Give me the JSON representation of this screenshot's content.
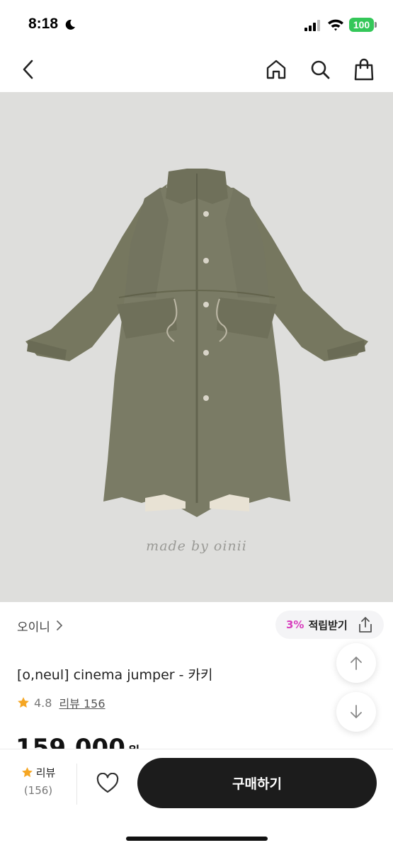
{
  "status_bar": {
    "time": "8:18",
    "battery": "100",
    "icons": [
      "moon-icon",
      "signal-icon",
      "wifi-icon"
    ]
  },
  "nav": {
    "icons": [
      "back-chevron-icon",
      "home-icon",
      "search-icon",
      "shopping-bag-icon"
    ]
  },
  "product": {
    "image_watermark": "made by oinii",
    "brand": "오이니",
    "reward": {
      "percent": "3%",
      "label": "적립받기"
    },
    "title": "[o,neul] cinema jumper - 카키",
    "rating": "4.8",
    "review_link": "리뷰 156",
    "price": "159,000",
    "price_unit": "원"
  },
  "bottom_bar": {
    "review_label": "리뷰",
    "review_count": "(156)",
    "buy_label": "구매하기"
  },
  "colors": {
    "accent_pink": "#d83fbd",
    "star": "#f5a623",
    "battery_green": "#34c759",
    "buy_button": "#1c1c1c",
    "coat_khaki": "#7a7b65",
    "image_background": "#dededc"
  }
}
